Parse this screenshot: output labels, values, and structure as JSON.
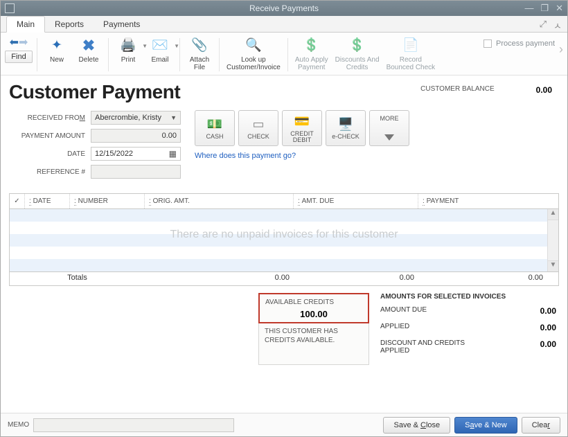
{
  "window": {
    "title": "Receive Payments"
  },
  "tabs": {
    "main": "Main",
    "reports": "Reports",
    "payments": "Payments"
  },
  "toolbar": {
    "find": "Find",
    "new": "New",
    "delete": "Delete",
    "print": "Print",
    "email": "Email",
    "attach_file": "Attach\nFile",
    "lookup": "Look up\nCustomer/Invoice",
    "auto_apply": "Auto Apply\nPayment",
    "discounts": "Discounts And\nCredits",
    "record_bounced": "Record\nBounced Check",
    "process_payment": "Process payment"
  },
  "header": {
    "title": "Customer Payment",
    "customer_balance_label": "CUSTOMER BALANCE",
    "customer_balance_value": "0.00"
  },
  "form": {
    "received_from_label_pre": "RECEIVED FRO",
    "received_from_label_u": "M",
    "received_from_value": "Abercrombie, Kristy",
    "payment_amount_label": "PAYMENT AMOUNT",
    "payment_amount_value": "0.00",
    "date_label": "DATE",
    "date_value": "12/15/2022",
    "reference_label": "REFERENCE #",
    "reference_value": ""
  },
  "pay_methods": {
    "cash": "CASH",
    "check": "CHECK",
    "credit": "CREDIT\nDEBIT",
    "echeck": "e-CHECK",
    "more": "MORE"
  },
  "link_text": "Where does this payment go?",
  "grid": {
    "cols": {
      "check": "✓",
      "date": "DATE",
      "number": "NUMBER",
      "orig": "ORIG. AMT.",
      "due": "AMT. DUE",
      "payment": "PAYMENT"
    },
    "empty_msg": "There are no unpaid invoices for this customer",
    "totals_label": "Totals",
    "totals_orig": "0.00",
    "totals_due": "0.00",
    "totals_pay": "0.00"
  },
  "credits": {
    "available_label": "AVAILABLE CREDITS",
    "available_value": "100.00",
    "note": "THIS CUSTOMER HAS CREDITS AVAILABLE."
  },
  "amounts": {
    "heading": "AMOUNTS FOR SELECTED INVOICES",
    "amount_due_label": "AMOUNT DUE",
    "amount_due_value": "0.00",
    "applied_label": "APPLIED",
    "applied_value": "0.00",
    "disc_label": "DISCOUNT AND CREDITS APPLIED",
    "disc_value": "0.00"
  },
  "bottom": {
    "memo_label": "MEMO",
    "memo_value": "",
    "save_close_pre": "Save & ",
    "save_close_u": "C",
    "save_close_post": "lose",
    "save_new_pre": "S",
    "save_new_u": "a",
    "save_new_post": "ve & New",
    "clear_pre": "Clea",
    "clear_u": "r"
  }
}
